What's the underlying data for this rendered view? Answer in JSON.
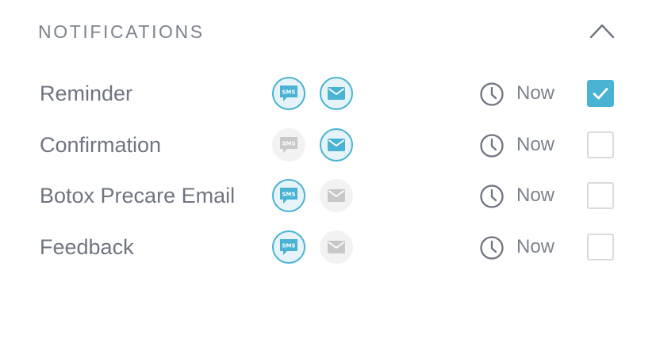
{
  "section": {
    "title": "NOTIFICATIONS",
    "toggle_icon": "chevron-up-icon"
  },
  "colors": {
    "accent": "#4ab3d3",
    "text": "#6f7480",
    "inactive_icon": "#c8c8c8"
  },
  "notifications": [
    {
      "label": "Reminder",
      "sms_icon_text": "SMS",
      "sms_enabled": true,
      "email_enabled": true,
      "timing": "Now",
      "checked": true
    },
    {
      "label": "Confirmation",
      "sms_icon_text": "SMS",
      "sms_enabled": false,
      "email_enabled": true,
      "timing": "Now",
      "checked": false
    },
    {
      "label": "Botox Precare Email",
      "sms_icon_text": "SMS",
      "sms_enabled": true,
      "email_enabled": false,
      "timing": "Now",
      "checked": false
    },
    {
      "label": "Feedback",
      "sms_icon_text": "SMS",
      "sms_enabled": true,
      "email_enabled": false,
      "timing": "Now",
      "checked": false
    }
  ]
}
